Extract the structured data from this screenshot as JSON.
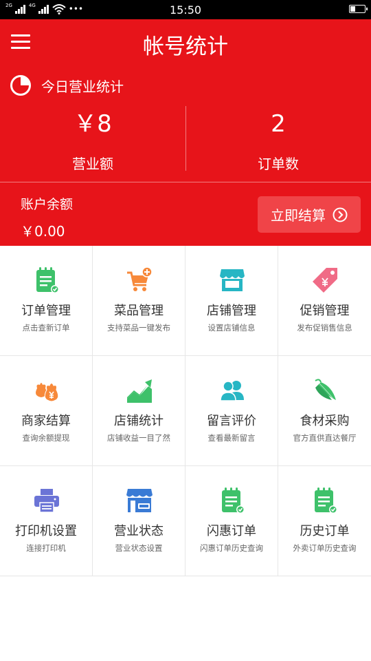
{
  "status_bar": {
    "network_1": "2G",
    "network_2": "4G",
    "dots": "•••",
    "time": "15:50"
  },
  "header": {
    "title": "帐号统计"
  },
  "today": {
    "label": "今日营业统计"
  },
  "stats": [
    {
      "value": "￥8",
      "label": "营业额"
    },
    {
      "value": "2",
      "label": "订单数"
    }
  ],
  "balance": {
    "label": "账户余额",
    "value": "￥0.00",
    "button_label": "立即结算"
  },
  "colors": {
    "primary_red": "#e7141a",
    "button_red": "#f04448"
  },
  "grid": [
    {
      "title": "订单管理",
      "subtitle": "点击查新订单",
      "icon": "order-icon"
    },
    {
      "title": "菜品管理",
      "subtitle": "支持菜品一键发布",
      "icon": "cart-add-icon"
    },
    {
      "title": "店铺管理",
      "subtitle": "设置店铺信息",
      "icon": "storefront-icon"
    },
    {
      "title": "促销管理",
      "subtitle": "发布促销售信息",
      "icon": "price-tag-icon"
    },
    {
      "title": "商家结算",
      "subtitle": "查询余额提现",
      "icon": "money-bag-icon"
    },
    {
      "title": "店铺统计",
      "subtitle": "店铺收益一目了然",
      "icon": "trend-chart-icon"
    },
    {
      "title": "留言评价",
      "subtitle": "查看最新留言",
      "icon": "users-icon"
    },
    {
      "title": "食材采购",
      "subtitle": "官方直供直达餐厅",
      "icon": "vegetable-icon"
    },
    {
      "title": "打印机设置",
      "subtitle": "连接打印机",
      "icon": "printer-icon"
    },
    {
      "title": "营业状态",
      "subtitle": "营业状态设置",
      "icon": "open-shop-icon"
    },
    {
      "title": "闪惠订单",
      "subtitle": "闪惠订单历史查询",
      "icon": "order-icon"
    },
    {
      "title": "历史订单",
      "subtitle": "外卖订单历史查询",
      "icon": "order-icon"
    }
  ]
}
